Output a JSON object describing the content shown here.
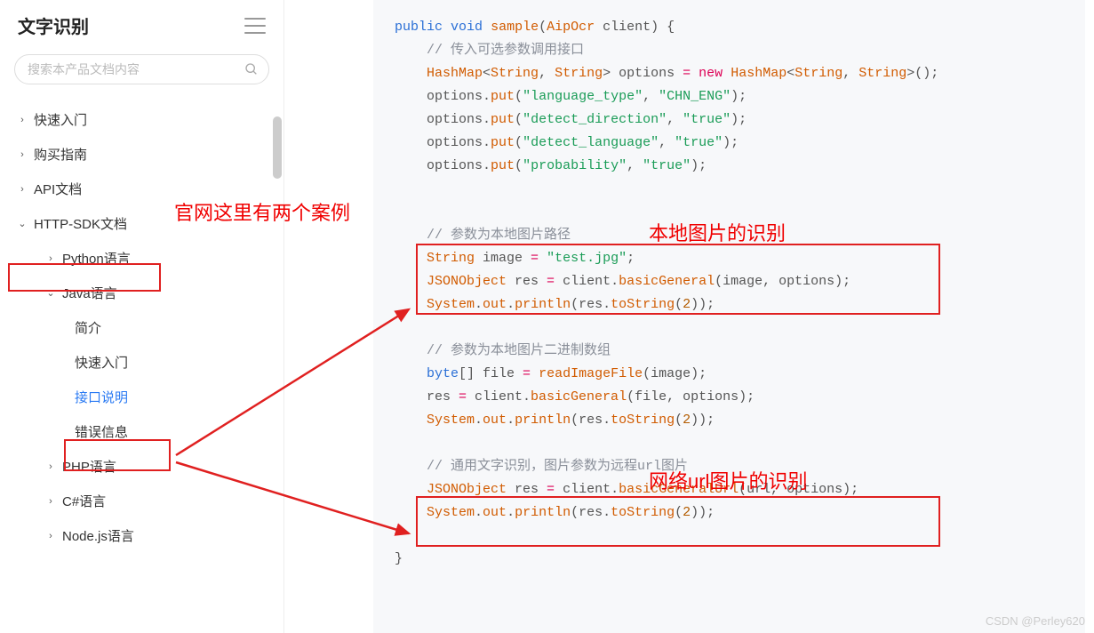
{
  "sidebar": {
    "title": "文字识别",
    "search_placeholder": "搜索本产品文档内容",
    "items": [
      {
        "label": "快速入门",
        "chev": "›",
        "level": 1
      },
      {
        "label": "购买指南",
        "chev": "›",
        "level": 1
      },
      {
        "label": "API文档",
        "chev": "›",
        "level": 1
      },
      {
        "label": "HTTP-SDK文档",
        "chev": "⌄",
        "level": 1,
        "boxed": true
      },
      {
        "label": "Python语言",
        "chev": "›",
        "level": 2
      },
      {
        "label": "Java语言",
        "chev": "⌄",
        "level": 2
      },
      {
        "label": "简介",
        "chev": "",
        "level": 3
      },
      {
        "label": "快速入门",
        "chev": "",
        "level": 3
      },
      {
        "label": "接口说明",
        "chev": "",
        "level": 3,
        "active": true,
        "boxed": true
      },
      {
        "label": "错误信息",
        "chev": "",
        "level": 3
      },
      {
        "label": "PHP语言",
        "chev": "›",
        "level": 2
      },
      {
        "label": "C#语言",
        "chev": "›",
        "level": 2
      },
      {
        "label": "Node.js语言",
        "chev": "›",
        "level": 2
      }
    ]
  },
  "annotations": {
    "two_examples": "官网这里有两个案例",
    "local_image": "本地图片的识别",
    "url_image": "网络url图片的识别"
  },
  "code": {
    "l1_public": "public",
    "l1_void": "void",
    "l1_sample": "sample",
    "l1_aipocr": "AipOcr",
    "l1_client": " client",
    "l1_open": ") {",
    "l2_comment": "// 传入可选参数调用接口",
    "l3_hashmap": "HashMap",
    "l3_string": "String",
    "l3_opts": " options ",
    "l3_new": "new",
    "l4_put": "put",
    "l4_k": "\"language_type\"",
    "l4_v": "\"CHN_ENG\"",
    "l5_k": "\"detect_direction\"",
    "l5_v": "\"true\"",
    "l6_k": "\"detect_language\"",
    "l6_v": "\"true\"",
    "l7_k": "\"probability\"",
    "l7_v": "\"true\"",
    "l9_comment": "// 参数为本地图片路径",
    "l10_image": " image ",
    "l10_val": "\"test.jpg\"",
    "l11_json": "JSONObject",
    "l11_res": " res ",
    "l11_client": " client",
    "l11_bg": "basicGeneral",
    "l12_system": "System",
    "l12_out": "out",
    "l12_println": "println",
    "l12_tostring": "toString",
    "l12_two": "2",
    "l14_comment": "// 参数为本地图片二进制数组",
    "l15_byte": "byte",
    "l15_file": "[] file ",
    "l15_read": "readImageFile",
    "l18_comment": "// 通用文字识别，图片参数为远程url图片",
    "l19_bgurl": "basicGeneralUrl",
    "l19_url": "url"
  },
  "watermark": "CSDN @Perley620"
}
